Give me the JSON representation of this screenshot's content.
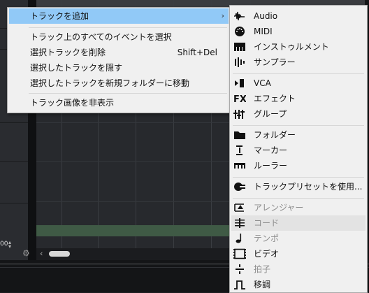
{
  "menu": {
    "items": [
      {
        "label": "トラックを追加",
        "shortcut": "",
        "submenu": true,
        "highlighted": true
      },
      {
        "label": "トラック上のすべてのイベントを選択",
        "shortcut": ""
      },
      {
        "label": "選択トラックを削除",
        "shortcut": "Shift+Del"
      },
      {
        "label": "選択したトラックを隠す",
        "shortcut": ""
      },
      {
        "label": "選択したトラックを新規フォルダーに移動",
        "shortcut": ""
      },
      {
        "label": "トラック画像を非表示",
        "shortcut": ""
      }
    ]
  },
  "submenu": {
    "items": [
      {
        "label": "Audio",
        "icon": "audio-waveform-icon"
      },
      {
        "label": "MIDI",
        "icon": "midi-connector-icon"
      },
      {
        "label": "インストゥルメント",
        "icon": "keyboard-icon"
      },
      {
        "label": "サンプラー",
        "icon": "sampler-icon"
      },
      {
        "label": "VCA",
        "icon": "vca-fader-icon"
      },
      {
        "label": "エフェクト",
        "icon": "fx-icon"
      },
      {
        "label": "グループ",
        "icon": "group-faders-icon"
      },
      {
        "label": "フォルダー",
        "icon": "folder-icon"
      },
      {
        "label": "マーカー",
        "icon": "marker-icon"
      },
      {
        "label": "ルーラー",
        "icon": "ruler-icon"
      },
      {
        "label": "トラックプリセットを使用...",
        "icon": "track-preset-icon"
      },
      {
        "label": "アレンジャー",
        "icon": "arranger-icon",
        "disabled": true
      },
      {
        "label": "コード",
        "icon": "chord-icon",
        "disabled": true
      },
      {
        "label": "テンポ",
        "icon": "tempo-note-icon",
        "disabled": true
      },
      {
        "label": "ビデオ",
        "icon": "video-film-icon",
        "disabled": false
      },
      {
        "label": "拍子",
        "icon": "signature-icon",
        "disabled": true
      },
      {
        "label": "移調",
        "icon": "transpose-icon",
        "disabled": false
      }
    ]
  },
  "background": {
    "zoom_value": "00"
  },
  "colors": {
    "highlight": "#91c9f7",
    "menu_bg": "#f0f0f0",
    "disabled_text": "#8c8c8c",
    "track_band": "#3f5a45"
  }
}
